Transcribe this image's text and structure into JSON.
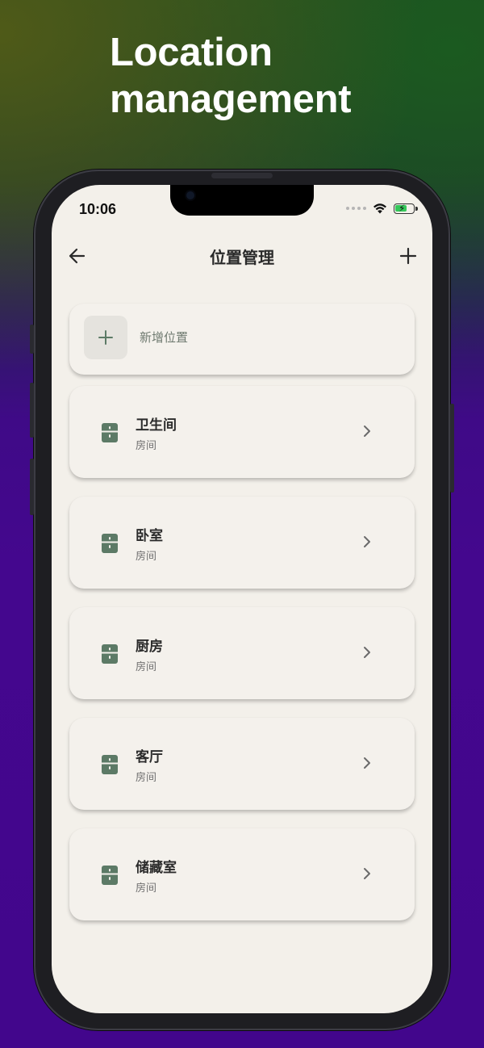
{
  "headline": {
    "line1": "Location",
    "line2": "management"
  },
  "status_bar": {
    "time": "10:06"
  },
  "navbar": {
    "title": "位置管理",
    "back_icon": "arrow-left-icon",
    "add_icon": "plus-icon"
  },
  "add_location": {
    "label": "新增位置",
    "icon": "plus-icon"
  },
  "locations": [
    {
      "name": "卫生间",
      "type": "房间",
      "icon": "fridge-icon"
    },
    {
      "name": "卧室",
      "type": "房间",
      "icon": "fridge-icon"
    },
    {
      "name": "厨房",
      "type": "房间",
      "icon": "fridge-icon"
    },
    {
      "name": "客厅",
      "type": "房间",
      "icon": "fridge-icon"
    },
    {
      "name": "储藏室",
      "type": "房间",
      "icon": "fridge-icon"
    }
  ],
  "colors": {
    "accent": "#5c7a66",
    "background": "#f3f0ea",
    "battery": "#34c759"
  }
}
